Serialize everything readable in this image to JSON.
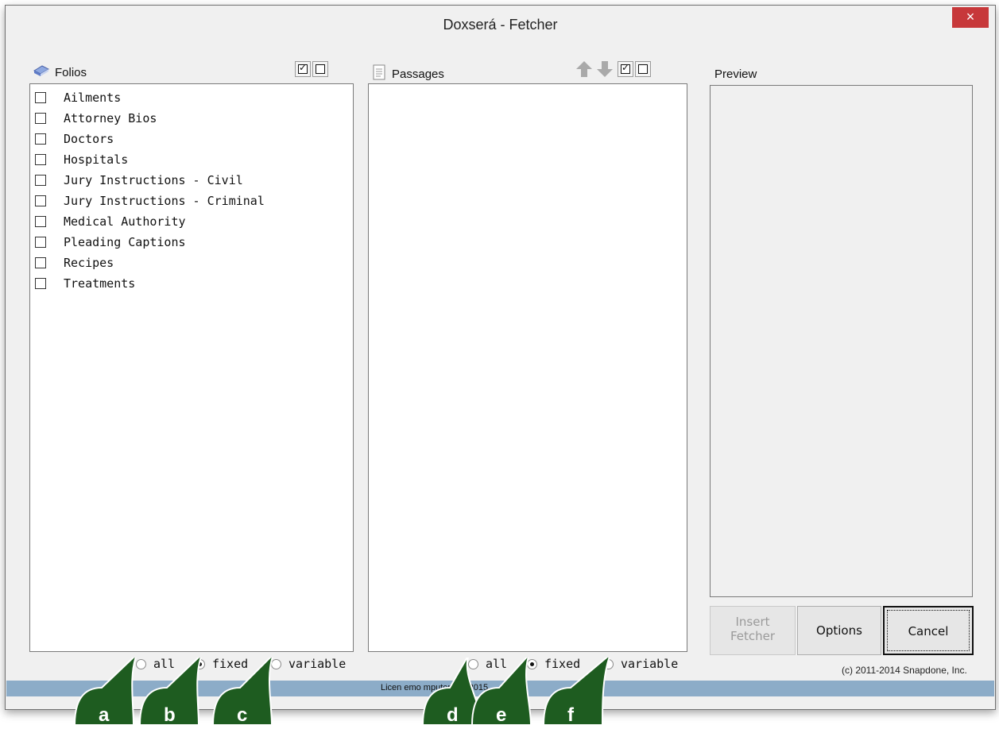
{
  "window": {
    "title": "Doxserá - Fetcher",
    "close_label": "×"
  },
  "folios": {
    "label": "Folios",
    "items": [
      "Ailments",
      "Attorney Bios",
      "Doctors",
      "Hospitals",
      "Jury Instructions - Civil",
      "Jury Instructions - Criminal",
      "Medical Authority",
      "Pleading Captions",
      "Recipes",
      "Treatments"
    ],
    "radio": {
      "all": "all",
      "fixed": "fixed",
      "variable": "variable",
      "selected": "fixed"
    }
  },
  "passages": {
    "label": "Passages",
    "radio": {
      "all": "all",
      "fixed": "fixed",
      "variable": "variable",
      "selected": "fixed"
    }
  },
  "preview": {
    "label": "Preview"
  },
  "buttons": {
    "insert_line1": "Insert",
    "insert_line2": "Fetcher",
    "options": "Options",
    "cancel": "Cancel"
  },
  "copyright": "(c) 2011-2014 Snapdone, Inc.",
  "status": {
    "text": "Licen          emo         mputer           Apr 2015"
  },
  "callouts": [
    "a",
    "b",
    "c",
    "d",
    "e",
    "f"
  ],
  "colors": {
    "callout_green": "#1e5c20",
    "close_red": "#c7383a",
    "status_blue": "#8cacc8"
  }
}
